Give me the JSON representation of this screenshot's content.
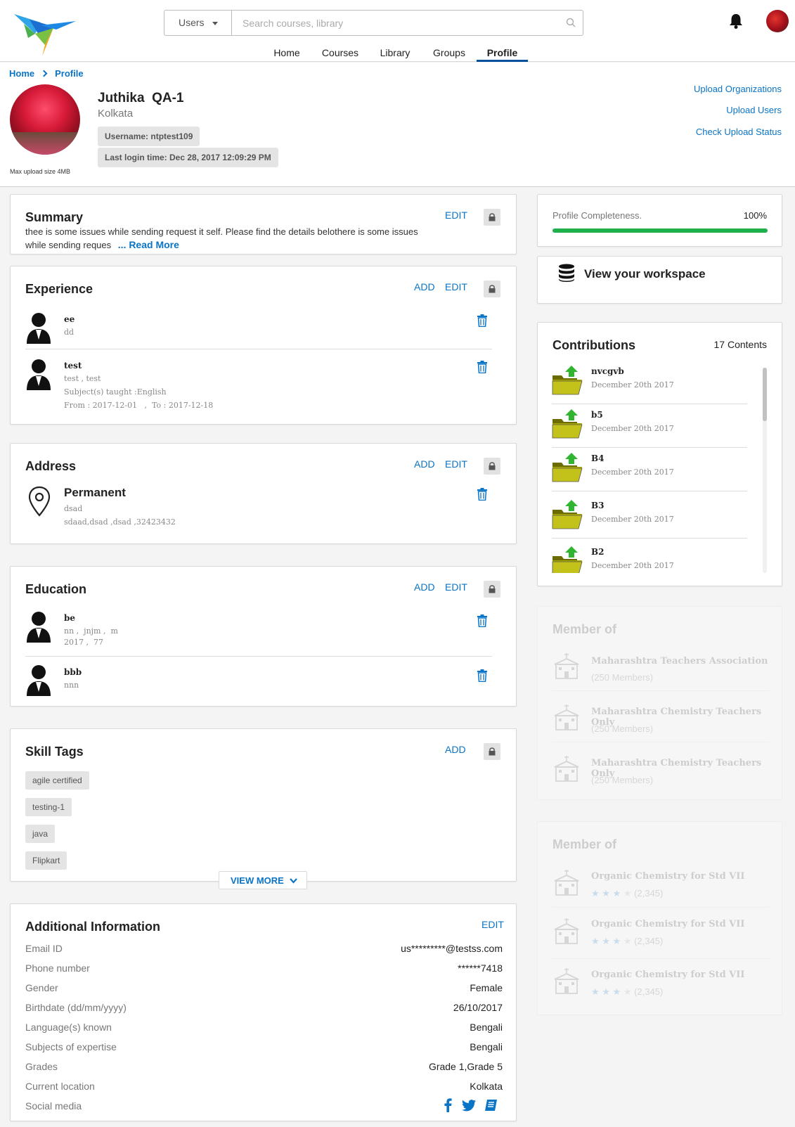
{
  "header": {
    "search_scope": "Users",
    "search_placeholder": "Search courses, library",
    "nav": [
      "Home",
      "Courses",
      "Library",
      "Groups",
      "Profile"
    ],
    "active_nav": "Profile"
  },
  "breadcrumb": {
    "home": "Home",
    "current": "Profile"
  },
  "profile": {
    "name": "Juthika  QA-1",
    "location": "Kolkata",
    "username": "Username: ntptest109",
    "last_login": "Last login time: Dec 28, 2017 12:09:29 PM",
    "max_upload": "Max upload size 4MB",
    "links": [
      "Upload Organizations",
      "Upload Users",
      "Check Upload Status"
    ]
  },
  "summary": {
    "title": "Summary",
    "edit": "EDIT",
    "line1": "thee is some issues while sending request it self. Please find the details belothere is some issues",
    "line2": "while sending reques",
    "read_more": "... Read More"
  },
  "experience": {
    "title": "Experience",
    "add": "ADD",
    "edit": "EDIT",
    "items": [
      {
        "title": "ee",
        "lines": [
          "dd"
        ]
      },
      {
        "title": "test",
        "lines": [
          "test , test",
          "Subject(s) taught :English",
          "From : 2017-12-01   ,  To : 2017-12-18"
        ]
      }
    ]
  },
  "address": {
    "title": "Address",
    "add": "ADD",
    "edit": "EDIT",
    "type": "Permanent",
    "line1": "dsad",
    "line2": "sdaad,dsad ,dsad ,32423432"
  },
  "education": {
    "title": "Education",
    "add": "ADD",
    "edit": "EDIT",
    "items": [
      {
        "title": "be",
        "lines": [
          "nn ,  jnjm ,  m",
          "2017 ,  77"
        ]
      },
      {
        "title": "bbb",
        "lines": [
          "nnn"
        ]
      }
    ]
  },
  "skills": {
    "title": "Skill Tags",
    "add": "ADD",
    "tags": [
      "agile certified",
      "testing-1",
      "java",
      "Flipkart"
    ],
    "view_more": "VIEW MORE"
  },
  "additional": {
    "title": "Additional Information",
    "edit": "EDIT",
    "rows": [
      {
        "label": "Email ID",
        "value": "us*********@testss.com"
      },
      {
        "label": "Phone number",
        "value": "******7418"
      },
      {
        "label": "Gender",
        "value": "Female"
      },
      {
        "label": "Birthdate (dd/mm/yyyy)",
        "value": "26/10/2017"
      },
      {
        "label": "Language(s) known",
        "value": "Bengali"
      },
      {
        "label": "Subjects of expertise",
        "value": "Bengali"
      },
      {
        "label": "Grades",
        "value": "Grade 1,Grade 5"
      },
      {
        "label": "Current location",
        "value": "Kolkata"
      },
      {
        "label": "Social media",
        "value": ""
      }
    ]
  },
  "completeness": {
    "label": "Profile Completeness.",
    "value": "100%",
    "fraction": 1.0
  },
  "workspace": {
    "label": "View your workspace"
  },
  "contributions": {
    "title": "Contributions",
    "count": "17 Contents",
    "items": [
      {
        "title": "nvcgvb",
        "date": "December 20th 2017"
      },
      {
        "title": "b5",
        "date": "December 20th 2017"
      },
      {
        "title": "B4",
        "date": "December 20th 2017"
      },
      {
        "title": "B3",
        "date": "December 20th 2017"
      },
      {
        "title": "B2",
        "date": "December 20th 2017"
      }
    ]
  },
  "member_orgs": {
    "title": "Member of",
    "items": [
      {
        "title": "Maharashtra Teachers Association",
        "sub": "(250 Members)"
      },
      {
        "title": "Maharashtra Chemistry Teachers Only",
        "sub": "(250 Members)"
      },
      {
        "title": "Maharashtra Chemistry Teachers Only",
        "sub": "(250 Members)"
      }
    ]
  },
  "member_courses": {
    "title": "Member of",
    "items": [
      {
        "title": "Organic Chemistry for Std VII",
        "sub": "(2,345)",
        "stars": 3
      },
      {
        "title": "Organic Chemistry for Std VII",
        "sub": "(2,345)",
        "stars": 3
      },
      {
        "title": "Organic Chemistry for Std VII",
        "sub": "(2,345)",
        "stars": 3
      }
    ]
  },
  "colors": {
    "accent": "#0a74c6",
    "progress": "#1fb04b",
    "nav_underline": "#024f9d"
  }
}
